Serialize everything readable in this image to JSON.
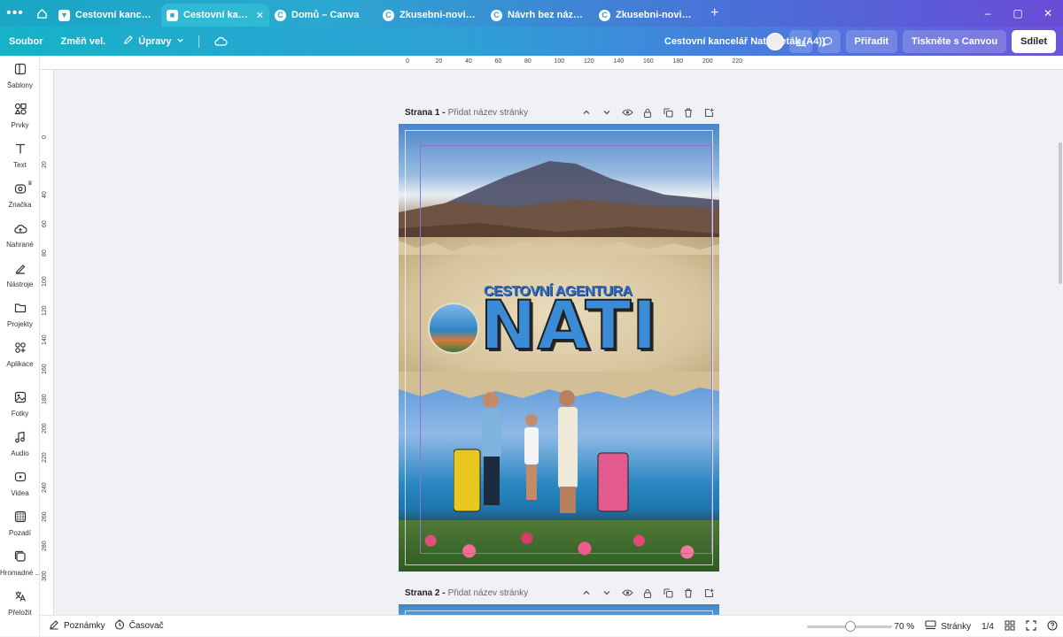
{
  "browser": {
    "tabs": [
      {
        "label": "Cestovní kancelář N...",
        "favicon": "C",
        "active": false
      },
      {
        "label": "Cestovní kancelář N...",
        "favicon": "C",
        "active": true
      },
      {
        "label": "Domů – Canva",
        "favicon": "C",
        "active": false
      },
      {
        "label": "Zkusebni-noviny – ...",
        "favicon": "C",
        "active": false
      },
      {
        "label": "Návrh bez názvu – ...",
        "favicon": "C",
        "active": false
      },
      {
        "label": "Zkusebni-noviny.af...",
        "favicon": "C",
        "active": false
      }
    ],
    "new_tab": "+",
    "window_controls": {
      "minimize": "–",
      "restore": "▢",
      "close": "✕"
    }
  },
  "toolbar": {
    "file": "Soubor",
    "resize": "Změň vel.",
    "edits": "Úpravy",
    "doc_title": "Cestovní kancelář Nati (Leták (A4))",
    "assign": "Přiřadit",
    "print": "Tiskněte s Canvou",
    "share": "Sdílet"
  },
  "sidebar": {
    "items": [
      {
        "label": "Šablony",
        "icon": "templates-icon"
      },
      {
        "label": "Prvky",
        "icon": "elements-icon"
      },
      {
        "label": "Text",
        "icon": "text-icon"
      },
      {
        "label": "Značka",
        "icon": "brand-icon"
      },
      {
        "label": "Nahrané",
        "icon": "upload-icon"
      },
      {
        "label": "Nástroje",
        "icon": "tools-icon"
      },
      {
        "label": "Projekty",
        "icon": "projects-icon"
      },
      {
        "label": "Aplikace",
        "icon": "apps-icon"
      },
      {
        "label": "Fotky",
        "icon": "photos-icon"
      },
      {
        "label": "Audio",
        "icon": "audio-icon"
      },
      {
        "label": "Videa",
        "icon": "videos-icon"
      },
      {
        "label": "Pozadí",
        "icon": "background-icon"
      },
      {
        "label": "Hromadné ...",
        "icon": "bulk-icon"
      },
      {
        "label": "Přeložit",
        "icon": "translate-icon"
      }
    ]
  },
  "ruler": {
    "top_ticks": [
      "0",
      "20",
      "40",
      "60",
      "80",
      "100",
      "120",
      "140",
      "160",
      "180",
      "200",
      "220"
    ],
    "left_ticks": [
      "0",
      "20",
      "40",
      "60",
      "80",
      "100",
      "120",
      "140",
      "160",
      "180",
      "200",
      "220",
      "240",
      "260",
      "280",
      "300"
    ]
  },
  "pages": [
    {
      "label": "Strana 1 -",
      "name_placeholder": "Přidat název stránky"
    },
    {
      "label": "Strana 2 -",
      "name_placeholder": "Přidat název stránky"
    }
  ],
  "design": {
    "subtitle": "CESTOVNÍ AGENTURA",
    "title": "NATI"
  },
  "bottom": {
    "notes": "Poznámky",
    "timer": "Časovač",
    "zoom": "70 %",
    "pages": "Stránky",
    "page_count": "1/4"
  }
}
